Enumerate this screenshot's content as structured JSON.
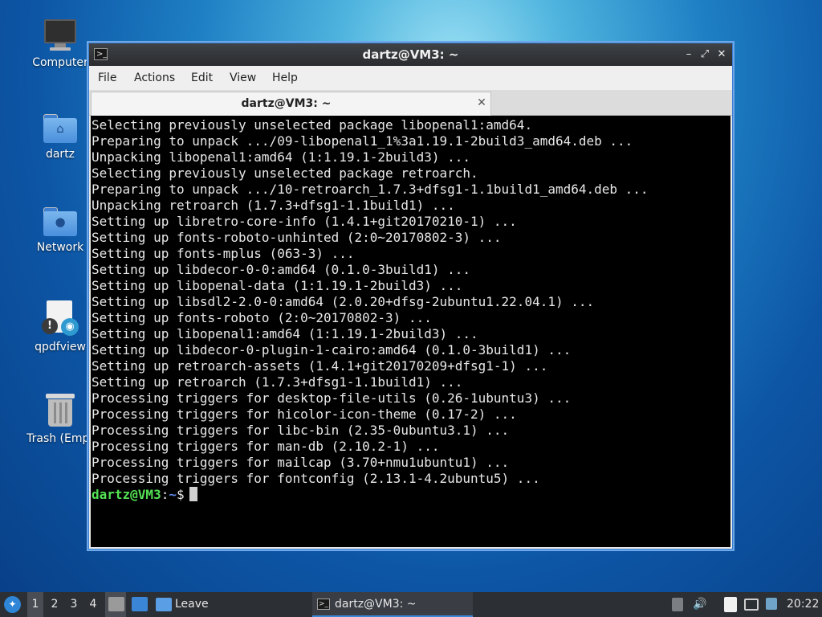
{
  "desktop": {
    "icons": [
      {
        "label": "Computer",
        "icon": "computer-icon"
      },
      {
        "label": "dartz",
        "icon": "home-folder-icon",
        "symbol": "⌂"
      },
      {
        "label": "Network",
        "icon": "network-folder-icon",
        "symbol": "●"
      },
      {
        "label": "qpdfview",
        "icon": "qpdfview-icon"
      },
      {
        "label": "Trash (Empt",
        "icon": "trash-icon"
      }
    ]
  },
  "window": {
    "title": "dartz@VM3: ~",
    "app_icon": ">_",
    "controls": {
      "minimize": "–",
      "maximize": "⤢",
      "close": "✕"
    },
    "menu": [
      "File",
      "Actions",
      "Edit",
      "View",
      "Help"
    ],
    "tab": {
      "label": "dartz@VM3: ~",
      "close": "✕"
    }
  },
  "terminal": {
    "lines": [
      "Selecting previously unselected package libopenal1:amd64.",
      "Preparing to unpack .../09-libopenal1_1%3a1.19.1-2build3_amd64.deb ...",
      "Unpacking libopenal1:amd64 (1:1.19.1-2build3) ...",
      "Selecting previously unselected package retroarch.",
      "Preparing to unpack .../10-retroarch_1.7.3+dfsg1-1.1build1_amd64.deb ...",
      "Unpacking retroarch (1.7.3+dfsg1-1.1build1) ...",
      "Setting up libretro-core-info (1.4.1+git20170210-1) ...",
      "Setting up fonts-roboto-unhinted (2:0~20170802-3) ...",
      "Setting up fonts-mplus (063-3) ...",
      "Setting up libdecor-0-0:amd64 (0.1.0-3build1) ...",
      "Setting up libopenal-data (1:1.19.1-2build3) ...",
      "Setting up libsdl2-2.0-0:amd64 (2.0.20+dfsg-2ubuntu1.22.04.1) ...",
      "Setting up fonts-roboto (2:0~20170802-3) ...",
      "Setting up libopenal1:amd64 (1:1.19.1-2build3) ...",
      "Setting up libdecor-0-plugin-1-cairo:amd64 (0.1.0-3build1) ...",
      "Setting up retroarch-assets (1.4.1+git20170209+dfsg1-1) ...",
      "Setting up retroarch (1.7.3+dfsg1-1.1build1) ...",
      "Processing triggers for desktop-file-utils (0.26-1ubuntu3) ...",
      "Processing triggers for hicolor-icon-theme (0.17-2) ...",
      "Processing triggers for libc-bin (2.35-0ubuntu3.1) ...",
      "Processing triggers for man-db (2.10.2-1) ...",
      "Processing triggers for mailcap (3.70+nmu1ubuntu1) ...",
      "Processing triggers for fontconfig (2.13.1-4.2ubuntu5) ..."
    ],
    "prompt": {
      "user_host": "dartz@VM3",
      "separator": ":",
      "path": "~",
      "symbol": "$"
    }
  },
  "taskbar": {
    "workspaces": [
      "1",
      "2",
      "3",
      "4"
    ],
    "active_workspace": "1",
    "quicklaunch_label": "Leave",
    "task": {
      "label": "dartz@VM3: ~",
      "icon": "terminal-icon"
    },
    "tray": {
      "volume_icon": "🔊"
    },
    "clock": "20:22"
  }
}
